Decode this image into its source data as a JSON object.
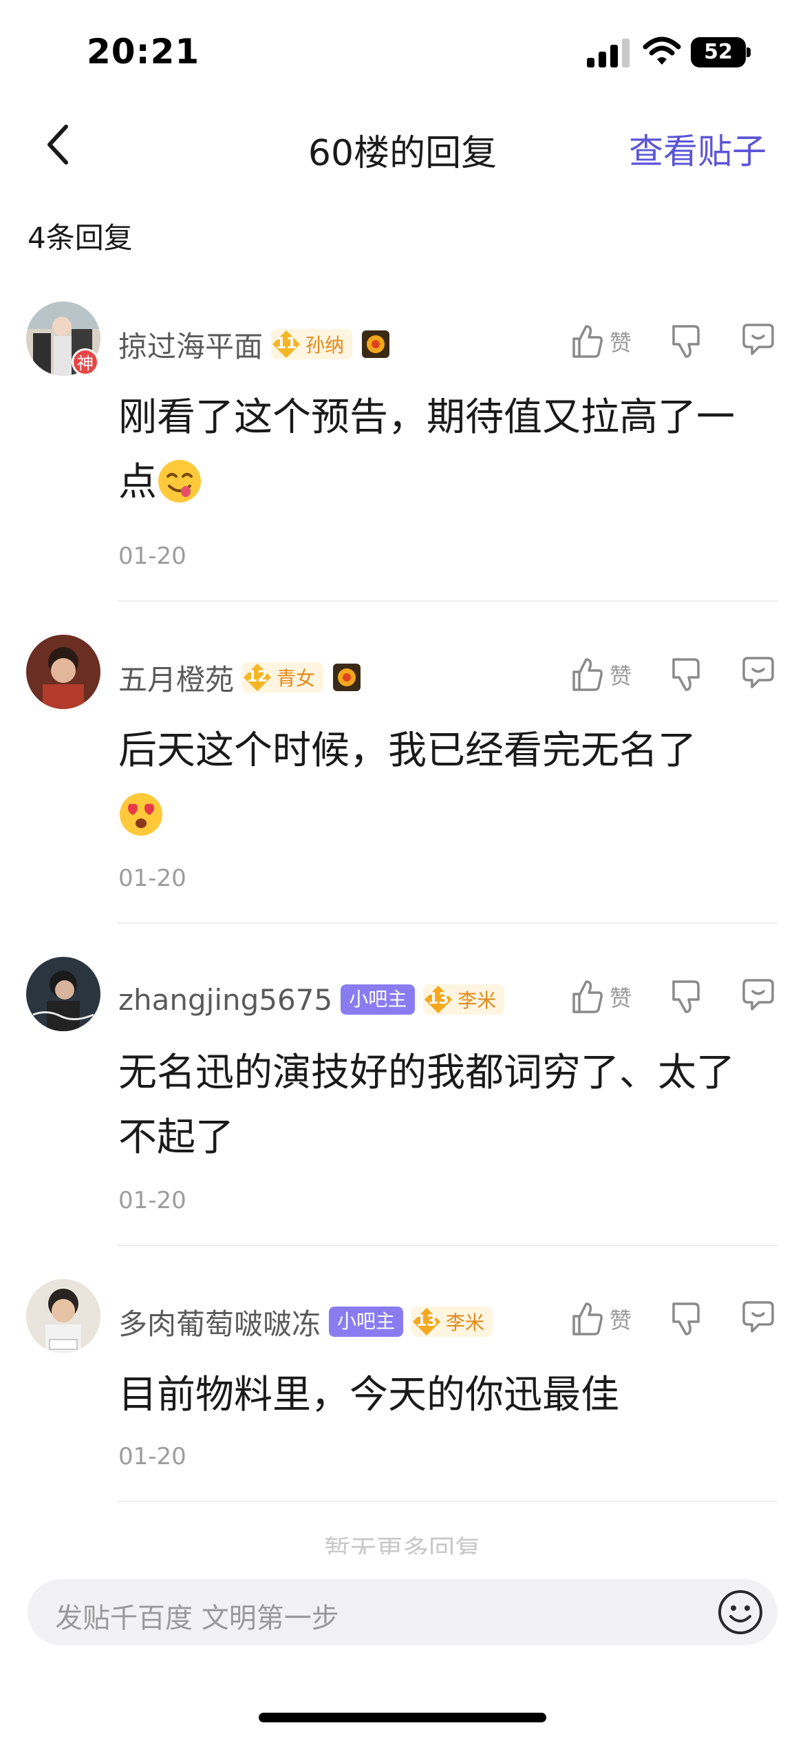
{
  "status_bar": {
    "time": "20:21",
    "battery": "52"
  },
  "nav": {
    "title": "60楼的回复",
    "view_post": "查看贴子"
  },
  "reply_count": "4条回复",
  "replies": [
    {
      "username": "掠过海平面",
      "avatar_badge": "神",
      "level": "11",
      "level_name": "孙纳",
      "owner_badge": "",
      "text": "刚看了这个预告，期待值又拉高了一点",
      "date": "01-20",
      "like_label": "赞"
    },
    {
      "username": "五月橙苑",
      "level": "12",
      "level_name": "青女",
      "owner_badge": "",
      "text": "后天这个时候，我已经看完无名了",
      "date": "01-20",
      "like_label": "赞"
    },
    {
      "username": "zhangjing5675",
      "owner_badge": "小吧主",
      "level": "13",
      "level_name": "李米",
      "text": "无名迅的演技好的我都词穷了、太了不起了",
      "date": "01-20",
      "like_label": "赞"
    },
    {
      "username": "多肉葡萄啵啵冻",
      "owner_badge": "小吧主",
      "level": "13",
      "level_name": "李米",
      "text": "目前物料里，今天的你迅最佳",
      "date": "01-20",
      "like_label": "赞"
    }
  ],
  "no_more": "暂无更多回复",
  "input": {
    "placeholder": "发贴千百度 文明第一步"
  },
  "colors": {
    "accent": "#5b55d6",
    "owner_badge": "#8a7cf0",
    "level_text": "#e08a1c"
  },
  "icons": [
    "back-icon",
    "thumb-up-icon",
    "thumb-down-icon",
    "comment-icon",
    "smiley-icon",
    "medal-icon",
    "signal-icon",
    "wifi-icon",
    "battery-icon"
  ]
}
